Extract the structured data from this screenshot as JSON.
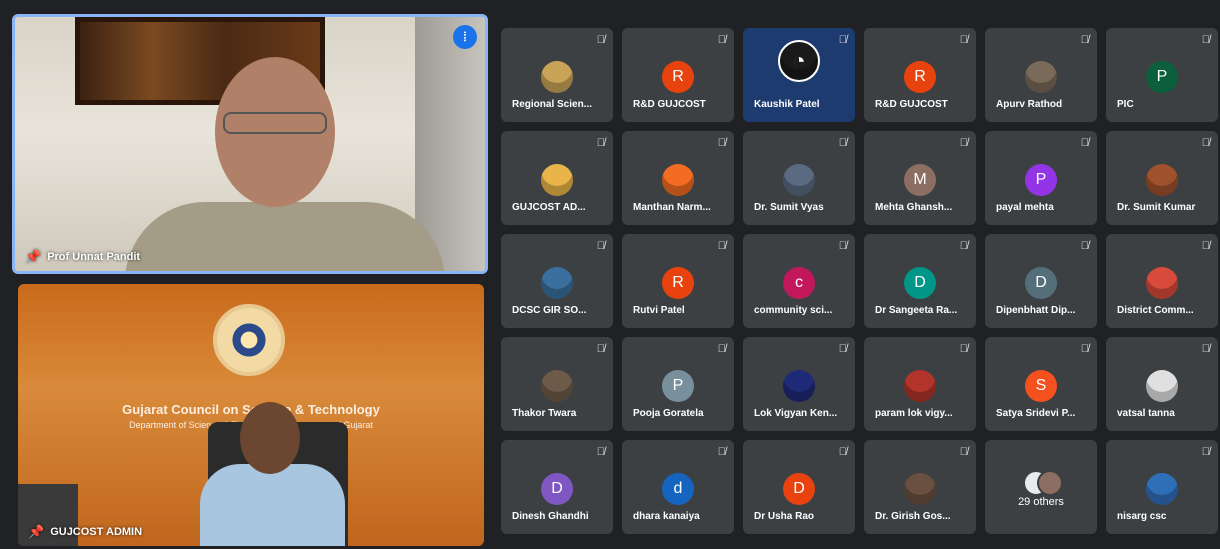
{
  "speaker": {
    "name": "Prof Unnat Pandit"
  },
  "admin": {
    "name": "GUJCOST ADMIN",
    "council": "Gujarat Council on Science & Technology",
    "dept": "Department of Science & Technology, Government of Gujarat"
  },
  "participants": [
    {
      "name": "Regional Scien...",
      "avatar_kind": "photo",
      "avatar_color": "#c9a456"
    },
    {
      "name": "R&D GUJCOST",
      "avatar_kind": "letter",
      "letter": "R",
      "avatar_color": "#e8430f"
    },
    {
      "name": "Kaushik Patel",
      "avatar_kind": "photo",
      "avatar_color": "#1a1a1a",
      "highlight": true
    },
    {
      "name": "R&D GUJCOST",
      "avatar_kind": "letter",
      "letter": "R",
      "avatar_color": "#e8430f"
    },
    {
      "name": "Apurv Rathod",
      "avatar_kind": "photo",
      "avatar_color": "#7a6a5a"
    },
    {
      "name": "PIC",
      "avatar_kind": "letter",
      "letter": "P",
      "avatar_color": "#0b5f3b"
    },
    {
      "name": "GUJCOST AD...",
      "avatar_kind": "photo",
      "avatar_color": "#e9b54a"
    },
    {
      "name": "Manthan Narm...",
      "avatar_kind": "photo",
      "avatar_color": "#f26d21"
    },
    {
      "name": "Dr. Sumit Vyas",
      "avatar_kind": "photo",
      "avatar_color": "#5a6a80"
    },
    {
      "name": "Mehta Ghansh...",
      "avatar_kind": "letter",
      "letter": "M",
      "avatar_color": "#8d6e63"
    },
    {
      "name": "payal mehta",
      "avatar_kind": "letter",
      "letter": "P",
      "avatar_color": "#9334e6"
    },
    {
      "name": "Dr. Sumit Kumar",
      "avatar_kind": "photo",
      "avatar_color": "#a0522d"
    },
    {
      "name": "DCSC GIR SO...",
      "avatar_kind": "photo",
      "avatar_color": "#3a6f9e"
    },
    {
      "name": "Rutvi Patel",
      "avatar_kind": "letter",
      "letter": "R",
      "avatar_color": "#e8430f"
    },
    {
      "name": "community sci...",
      "avatar_kind": "letter",
      "letter": "c",
      "avatar_color": "#c2185b"
    },
    {
      "name": "Dr Sangeeta Ra...",
      "avatar_kind": "letter",
      "letter": "D",
      "avatar_color": "#009688"
    },
    {
      "name": "Dipenbhatt Dip...",
      "avatar_kind": "letter",
      "letter": "D",
      "avatar_color": "#546e7a"
    },
    {
      "name": "District Comm...",
      "avatar_kind": "photo",
      "avatar_color": "#d84a3a"
    },
    {
      "name": "Thakor Twara",
      "avatar_kind": "photo",
      "avatar_color": "#6d5a48"
    },
    {
      "name": "Pooja Goratela",
      "avatar_kind": "letter",
      "letter": "P",
      "avatar_color": "#78909c"
    },
    {
      "name": "Lok Vigyan Ken...",
      "avatar_kind": "photo",
      "avatar_color": "#1e2a78"
    },
    {
      "name": "param lok vigy...",
      "avatar_kind": "photo",
      "avatar_color": "#b3342a"
    },
    {
      "name": "Satya Sridevi P...",
      "avatar_kind": "letter",
      "letter": "S",
      "avatar_color": "#f4511e"
    },
    {
      "name": "vatsal tanna",
      "avatar_kind": "photo",
      "avatar_color": "#e0e0e0"
    },
    {
      "name": "Dinesh Ghandhi",
      "avatar_kind": "letter",
      "letter": "D",
      "avatar_color": "#7e57c2"
    },
    {
      "name": "dhara kanaiya",
      "avatar_kind": "letter",
      "letter": "d",
      "avatar_color": "#1565c0"
    },
    {
      "name": "Dr Usha Rao",
      "avatar_kind": "letter",
      "letter": "D",
      "avatar_color": "#e8430f"
    },
    {
      "name": "Dr. Girish Gos...",
      "avatar_kind": "photo",
      "avatar_color": "#6a5040"
    },
    {
      "name": "29 others",
      "avatar_kind": "others",
      "avatar_color": "#ffffff"
    },
    {
      "name": "nisarg csc",
      "avatar_kind": "photo",
      "avatar_color": "#2f6fb8"
    }
  ]
}
